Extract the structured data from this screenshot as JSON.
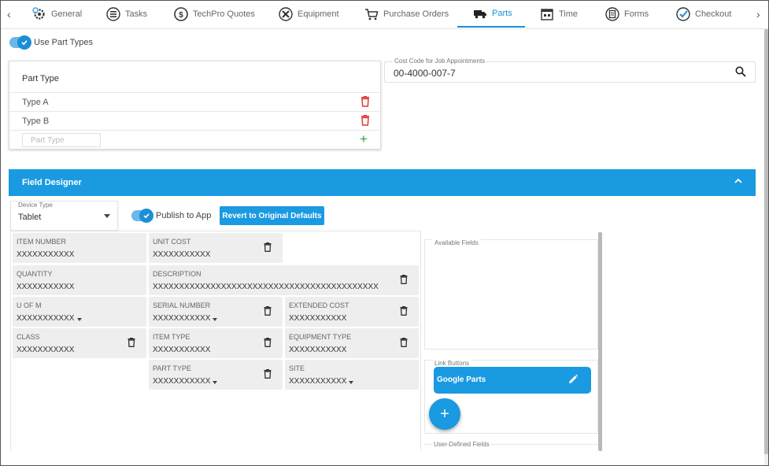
{
  "tabs": [
    {
      "label": "General",
      "icon": "gear-clock-icon",
      "active": false
    },
    {
      "label": "Tasks",
      "icon": "list-icon",
      "active": false
    },
    {
      "label": "TechPro Quotes",
      "icon": "dollar-bubble-icon",
      "active": false
    },
    {
      "label": "Equipment",
      "icon": "tools-icon",
      "active": false
    },
    {
      "label": "Purchase Orders",
      "icon": "cart-icon",
      "active": false
    },
    {
      "label": "Parts",
      "icon": "truck-icon",
      "active": true
    },
    {
      "label": "Time",
      "icon": "calendar-icon",
      "active": false
    },
    {
      "label": "Forms",
      "icon": "clipboard-icon",
      "active": false
    },
    {
      "label": "Checkout",
      "icon": "check-circle-icon",
      "active": false
    }
  ],
  "use_part_types": {
    "label": "Use Part Types",
    "on": true
  },
  "part_types": {
    "header": "Part Type",
    "rows": [
      "Type A",
      "Type B"
    ],
    "input_placeholder": "Part Type"
  },
  "cost_code": {
    "label": "Cost Code for Job Appointments",
    "value": "00-4000-007-7"
  },
  "field_designer": {
    "title": "Field Designer"
  },
  "device_type": {
    "label": "Device Type",
    "value": "Tablet"
  },
  "publish_to_app": {
    "label": "Publish to App",
    "on": true
  },
  "revert_button": "Revert to Original Defaults",
  "fields": {
    "item_number": {
      "label": "ITEM NUMBER",
      "value": "XXXXXXXXXXX"
    },
    "unit_cost": {
      "label": "UNIT COST",
      "value": "XXXXXXXXXXX"
    },
    "quantity": {
      "label": "QUANTITY",
      "value": "XXXXXXXXXXX"
    },
    "description": {
      "label": "DESCRIPTION",
      "value": "XXXXXXXXXXXXXXXXXXXXXXXXXXXXXXXXXXXXXXXXXXX"
    },
    "u_of_m": {
      "label": "U OF M",
      "value": "XXXXXXXXXXX"
    },
    "serial_number": {
      "label": "SERIAL NUMBER",
      "value": "XXXXXXXXXXX"
    },
    "extended_cost": {
      "label": "EXTENDED COST",
      "value": "XXXXXXXXXXX"
    },
    "class": {
      "label": "CLASS",
      "value": "XXXXXXXXXXX"
    },
    "item_type": {
      "label": "ITEM TYPE",
      "value": "XXXXXXXXXXX"
    },
    "equipment_type": {
      "label": "EQUIPMENT TYPE",
      "value": "XXXXXXXXXXX"
    },
    "part_type": {
      "label": "PART TYPE",
      "value": "XXXXXXXXXXX"
    },
    "site": {
      "label": "SITE",
      "value": "XXXXXXXXXXX"
    }
  },
  "available_fields": {
    "label": "Available Fields"
  },
  "link_buttons": {
    "label": "Link Buttons",
    "google_parts": "Google Parts"
  },
  "user_defined_fields": {
    "label": "User-Defined Fields"
  },
  "colors": {
    "accent": "#1a9ae0",
    "delete": "#e53935",
    "add": "#2e9e3e"
  }
}
